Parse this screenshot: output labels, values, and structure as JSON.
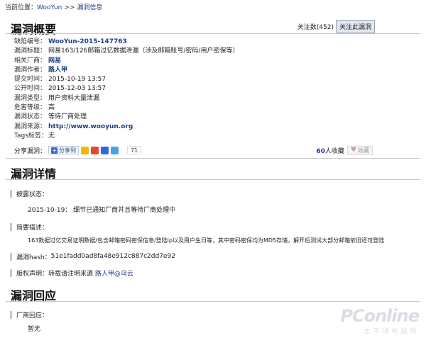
{
  "breadcrumb": {
    "prefix": "当前位置：",
    "home": "WooYun",
    "separator": ">>",
    "current": "漏洞信息"
  },
  "overview": {
    "title": "漏洞概要",
    "follow_count_label": "关注数(452)",
    "follow_button": "关注此漏洞",
    "fields": [
      {
        "key": "缺陷编号：",
        "value": "WooYun-2015-147763"
      },
      {
        "key": "漏洞标题：",
        "value": "网易163/126邮箱过亿数据泄漏（涉及邮箱账号/密码/用户密保等）"
      },
      {
        "key": "相关厂商：",
        "value": "网易"
      },
      {
        "key": "漏洞作者：",
        "value": "路人甲"
      },
      {
        "key": "提交时间：",
        "value": "2015-10-19 13:57"
      },
      {
        "key": "公开时间：",
        "value": "2015-12-03 13:57"
      },
      {
        "key": "漏洞类型：",
        "value": "用户资料大量泄漏"
      },
      {
        "key": "危害等级：",
        "value": "高"
      },
      {
        "key": "漏洞状态：",
        "value": "等待厂商处理"
      },
      {
        "key": "漏洞来源：",
        "value": "http://www.wooyun.org"
      },
      {
        "key": "Tags标签：",
        "value": "无"
      }
    ],
    "share": {
      "label": "分享漏洞：",
      "button": "分享到",
      "count": "71"
    },
    "favorites": {
      "count": "60",
      "suffix": "人收藏",
      "button": "收藏"
    }
  },
  "details": {
    "title": "漏洞详情",
    "disclosure_label": "披露状态：",
    "disclosure_text": "2015-10-19： 细节已通知厂商并且等待厂商处理中",
    "summary_label": "简要描述：",
    "summary_text": "163数据过亿交易证明数据/包含邮箱密码密保信息/登陆ip以及用户生日等，其中密码密保均为MD5存储，解开后测试大部分邮箱依旧还可登陆",
    "hash_label": "漏洞hash：",
    "hash_value": "51e1fadd0ad8fa48e912c887c2dd7e92",
    "copyright_label": "版权声明：",
    "copyright_text": "转载请注明来源 ",
    "copyright_link": "路人甲@乌云"
  },
  "response": {
    "title": "漏洞回应",
    "vendor_label": "厂商回应：",
    "vendor_text": "暂无"
  },
  "watermark": {
    "main": "PConline",
    "sub": "太平洋电脑网"
  },
  "colors": {
    "link": "#1a3f8a",
    "rule": "#c8c8c8",
    "bar": "#c7c7c7"
  }
}
